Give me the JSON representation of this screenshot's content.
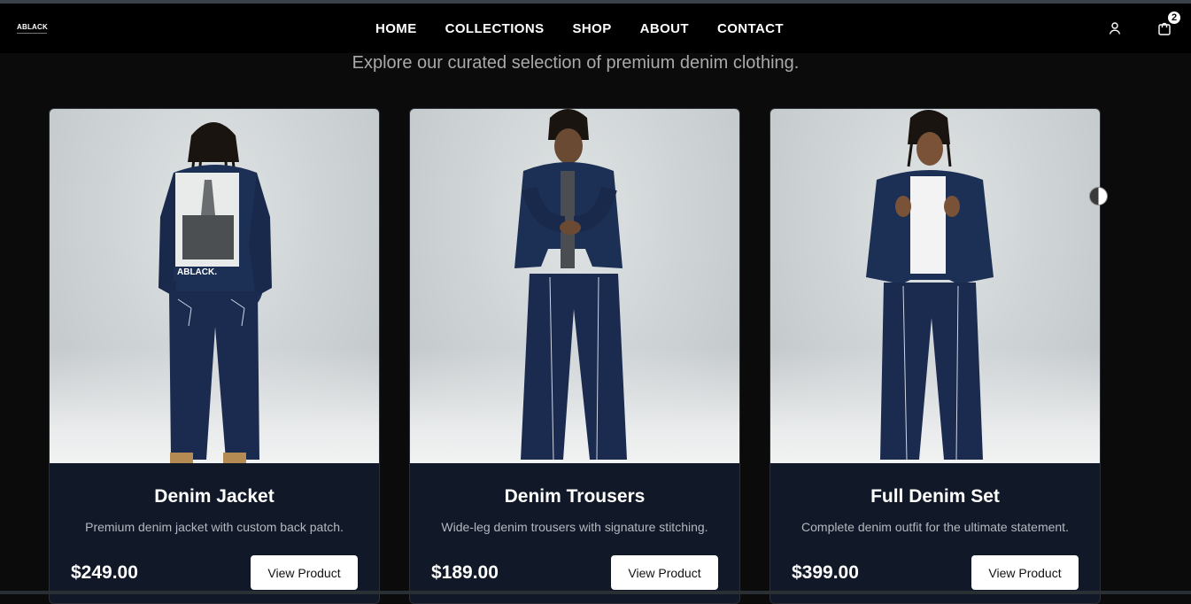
{
  "header": {
    "logo_text": "ABLACK",
    "nav": [
      "HOME",
      "COLLECTIONS",
      "SHOP",
      "ABOUT",
      "CONTACT"
    ],
    "cart_count": "2"
  },
  "subtitle": "Explore our curated selection of premium denim clothing.",
  "products": [
    {
      "title": "Denim Jacket",
      "description": "Premium denim jacket with custom back patch.",
      "price": "$249.00",
      "button": "View Product",
      "patch_text": "ABLACK."
    },
    {
      "title": "Denim Trousers",
      "description": "Wide-leg denim trousers with signature stitching.",
      "price": "$189.00",
      "button": "View Product"
    },
    {
      "title": "Full Denim Set",
      "description": "Complete denim outfit for the ultimate statement.",
      "price": "$399.00",
      "button": "View Product"
    }
  ],
  "colors": {
    "denim": "#1c2f55",
    "card_bg": "#111827",
    "nav_bg": "#000000"
  }
}
